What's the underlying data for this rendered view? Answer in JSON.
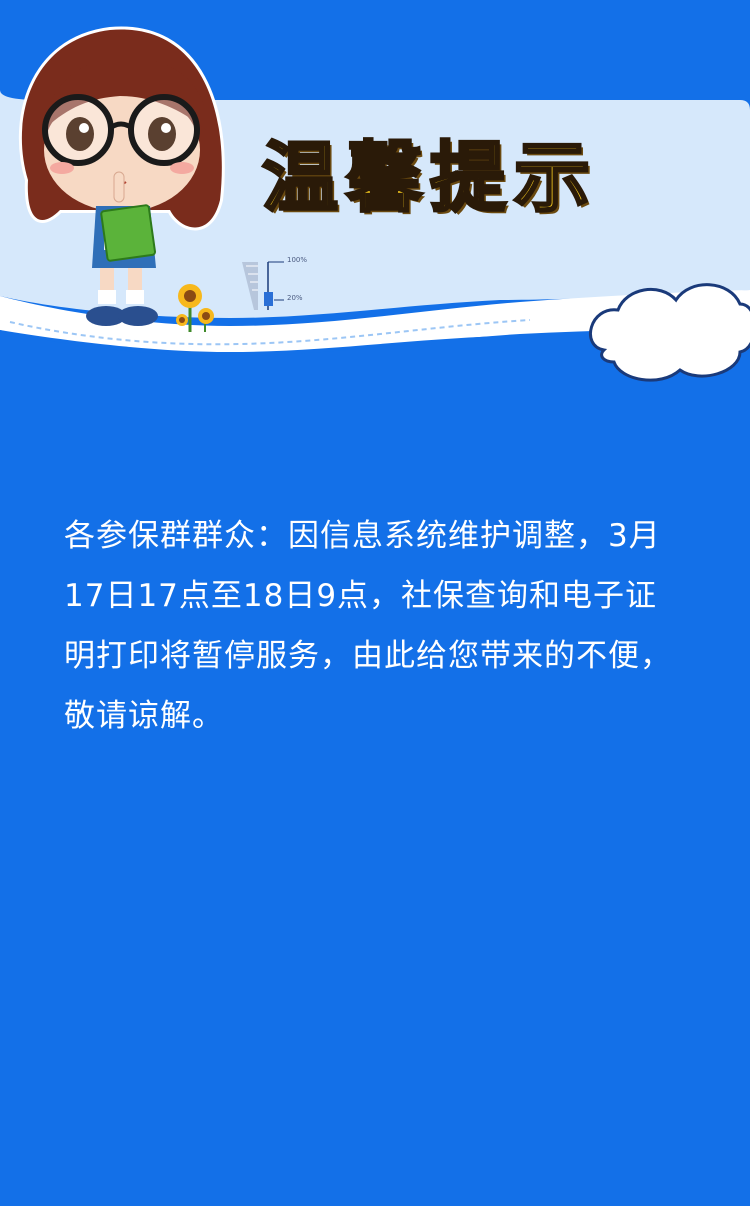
{
  "header": {
    "title": "温馨提示",
    "gauge_top_label": "100%",
    "gauge_bottom_label": "20%"
  },
  "notice": {
    "text": "各参保群群众：因信息系统维护调整，3月17日17点至18日9点，社保查询和电子证明打印将暂停服务，由此给您带来的不便，敬请谅解。"
  },
  "colors": {
    "background": "#1370e8",
    "banner_light": "#d7e9fb",
    "title_fill": "#ffd21f",
    "text": "#ffffff"
  }
}
